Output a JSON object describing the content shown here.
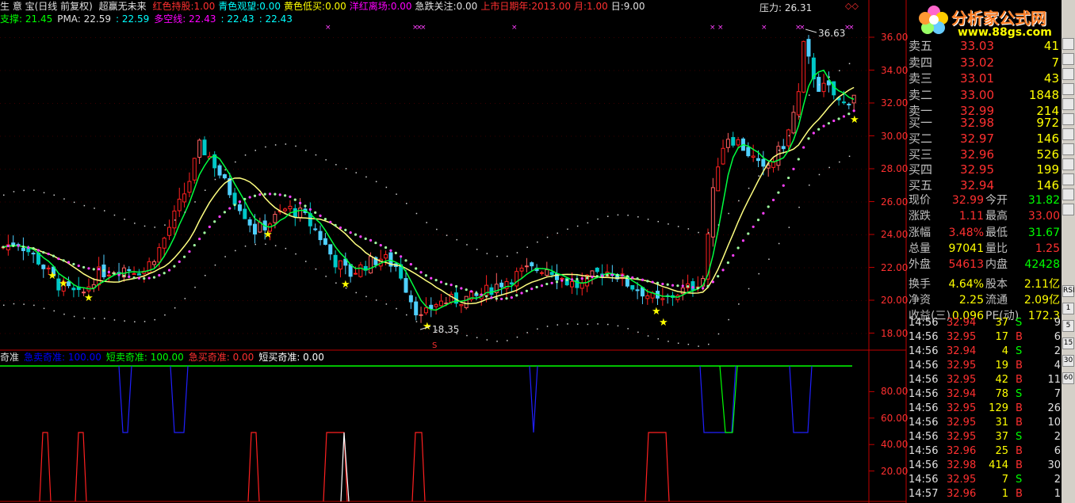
{
  "header": {
    "title_prefix": "生 意 宝(日线 前复权)",
    "indicator_name": "超赢无未来",
    "items": [
      {
        "label": "红色持股:",
        "value": "1.00",
        "color": "#ff3030"
      },
      {
        "label": "青色观望:",
        "value": "0.00",
        "color": "#00ffff"
      },
      {
        "label": "黄色低买:",
        "value": "0.00",
        "color": "#ffff00"
      },
      {
        "label": "洋红离场:",
        "value": "0.00",
        "color": "#ff00ff"
      },
      {
        "label": "急跌关注:",
        "value": "0.00",
        "color": "#e0e0e0"
      },
      {
        "label": "上市日期年:",
        "value": "2013.00",
        "color": "#ff3030"
      },
      {
        "label": "月:",
        "value": "1.00",
        "color": "#ff3030"
      },
      {
        "label": "日:",
        "value": "9.00",
        "color": "#e0e0e0"
      }
    ],
    "pressure": "压力: 26.31",
    "line2": [
      {
        "text": "支撑: 21.45",
        "color": "#00ff00"
      },
      {
        "text": "PMA: 22.59",
        "color": "#e0e0e0"
      },
      {
        "text": ": 22.59",
        "color": "#00ffff"
      },
      {
        "text": "多空线: 22.43",
        "color": "#ff00ff"
      },
      {
        "text": ": 22.43",
        "color": "#00ffff"
      },
      {
        "text": ": 22.43",
        "color": "#00ffff"
      }
    ]
  },
  "price_axis": [
    "36.00",
    "34.00",
    "32.00",
    "30.00",
    "28.00",
    "26.00",
    "24.00",
    "22.00",
    "20.00",
    "18.00"
  ],
  "sub_axis": [
    "80.00",
    "60.00",
    "40.00",
    "20.00"
  ],
  "annotations": {
    "high": "36.63",
    "low": "18.35"
  },
  "sub_header": [
    {
      "text": "奇准",
      "color": "#e0e0e0"
    },
    {
      "text": "急卖奇准: 100.00",
      "color": "#0000ff"
    },
    {
      "text": "短卖奇准: 100.00",
      "color": "#00ff00"
    },
    {
      "text": "急买奇准: 0.00",
      "color": "#ff3030"
    },
    {
      "text": "短买奇准: 0.00",
      "color": "#ffffff"
    }
  ],
  "logo": {
    "title": "分析家公式网",
    "url": "www.88gs.com"
  },
  "order_book": {
    "sells": [
      {
        "label": "卖五",
        "price": "33.03",
        "vol": "41"
      },
      {
        "label": "卖四",
        "price": "33.02",
        "vol": "7"
      },
      {
        "label": "卖三",
        "price": "33.01",
        "vol": "43"
      },
      {
        "label": "卖二",
        "price": "33.00",
        "vol": "1848"
      },
      {
        "label": "卖一",
        "price": "32.99",
        "vol": "214"
      }
    ],
    "buys": [
      {
        "label": "买一",
        "price": "32.98",
        "vol": "972"
      },
      {
        "label": "买二",
        "price": "32.97",
        "vol": "146"
      },
      {
        "label": "买三",
        "price": "32.96",
        "vol": "526"
      },
      {
        "label": "买四",
        "price": "32.95",
        "vol": "199"
      },
      {
        "label": "买五",
        "price": "32.94",
        "vol": "146"
      }
    ]
  },
  "quote": [
    {
      "l1": "现价",
      "v1": "32.99",
      "c1": "#ff3030",
      "l2": "今开",
      "v2": "31.82",
      "c2": "#00ff00"
    },
    {
      "l1": "涨跌",
      "v1": "1.11",
      "c1": "#ff3030",
      "l2": "最高",
      "v2": "33.00",
      "c2": "#ff3030"
    },
    {
      "l1": "涨幅",
      "v1": "3.48%",
      "c1": "#ff3030",
      "l2": "最低",
      "v2": "31.67",
      "c2": "#00ff00"
    },
    {
      "l1": "总量",
      "v1": "97041",
      "c1": "#ffff00",
      "l2": "量比",
      "v2": "1.25",
      "c2": "#ff3030"
    },
    {
      "l1": "外盘",
      "v1": "54613",
      "c1": "#ff3030",
      "l2": "内盘",
      "v2": "42428",
      "c2": "#00ff00"
    },
    {
      "l1": "换手",
      "v1": "4.64%",
      "c1": "#ffff00",
      "l2": "股本",
      "v2": "2.11亿",
      "c2": "#ffff00"
    },
    {
      "l1": "净资",
      "v1": "2.25",
      "c1": "#ffff00",
      "l2": "流通",
      "v2": "2.09亿",
      "c2": "#ffff00"
    },
    {
      "l1": "收益(三)",
      "v1": "0.096",
      "c1": "#ffff00",
      "l2": "PE(动)",
      "v2": "172.3",
      "c2": "#ffff00"
    }
  ],
  "ticks": [
    {
      "time": "14:56",
      "price": "32.94",
      "vol": "37",
      "side": "S",
      "n": "9"
    },
    {
      "time": "14:56",
      "price": "32.95",
      "vol": "17",
      "side": "B",
      "n": "6"
    },
    {
      "time": "14:56",
      "price": "32.94",
      "vol": "4",
      "side": "S",
      "n": "2"
    },
    {
      "time": "14:56",
      "price": "32.95",
      "vol": "19",
      "side": "B",
      "n": "4"
    },
    {
      "time": "14:56",
      "price": "32.95",
      "vol": "42",
      "side": "B",
      "n": "11"
    },
    {
      "time": "14:56",
      "price": "32.94",
      "vol": "78",
      "side": "S",
      "n": "7"
    },
    {
      "time": "14:56",
      "price": "32.95",
      "vol": "129",
      "side": "B",
      "n": "26"
    },
    {
      "time": "14:56",
      "price": "32.95",
      "vol": "31",
      "side": "B",
      "n": "10"
    },
    {
      "time": "14:56",
      "price": "32.95",
      "vol": "37",
      "side": "S",
      "n": "2"
    },
    {
      "time": "14:56",
      "price": "32.96",
      "vol": "25",
      "side": "B",
      "n": "6"
    },
    {
      "time": "14:56",
      "price": "32.98",
      "vol": "414",
      "side": "B",
      "n": "30"
    },
    {
      "time": "14:56",
      "price": "32.95",
      "vol": "7",
      "side": "S",
      "n": "2"
    },
    {
      "time": "14:57",
      "price": "32.96",
      "vol": "1",
      "side": "B",
      "n": "1"
    }
  ],
  "sidebar_labels": [
    "RSI",
    "1",
    "5",
    "15",
    "30",
    "60"
  ]
}
